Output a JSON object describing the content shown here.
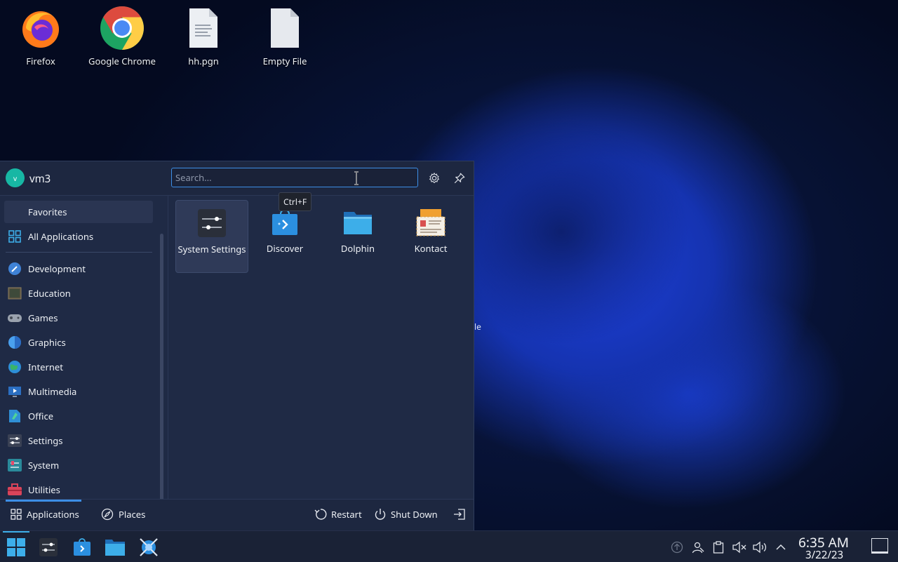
{
  "desktop": {
    "icons": [
      {
        "label": "Firefox"
      },
      {
        "label": "Google Chrome"
      },
      {
        "label": "hh.pgn"
      },
      {
        "label": "Empty File"
      }
    ],
    "peek_text": "le"
  },
  "launcher": {
    "user": {
      "initial": "v",
      "name": "vm3"
    },
    "search": {
      "placeholder": "Search..."
    },
    "tooltip": "Ctrl+F",
    "sidebar": {
      "favorites": "Favorites",
      "all_apps": "All Applications",
      "categories": [
        "Development",
        "Education",
        "Games",
        "Graphics",
        "Internet",
        "Multimedia",
        "Office",
        "Settings",
        "System",
        "Utilities"
      ]
    },
    "apps": [
      {
        "label": "System Settings"
      },
      {
        "label": "Discover"
      },
      {
        "label": "Dolphin"
      },
      {
        "label": "Kontact"
      }
    ],
    "footer": {
      "tab_applications": "Applications",
      "tab_places": "Places",
      "restart": "Restart",
      "shutdown": "Shut Down"
    }
  },
  "taskbar": {
    "time": "6:35 AM",
    "date": "3/22/23"
  },
  "colors": {
    "accent": "#3d8ee6",
    "panel": "#1f2a45",
    "taskbar": "#1a2236"
  }
}
